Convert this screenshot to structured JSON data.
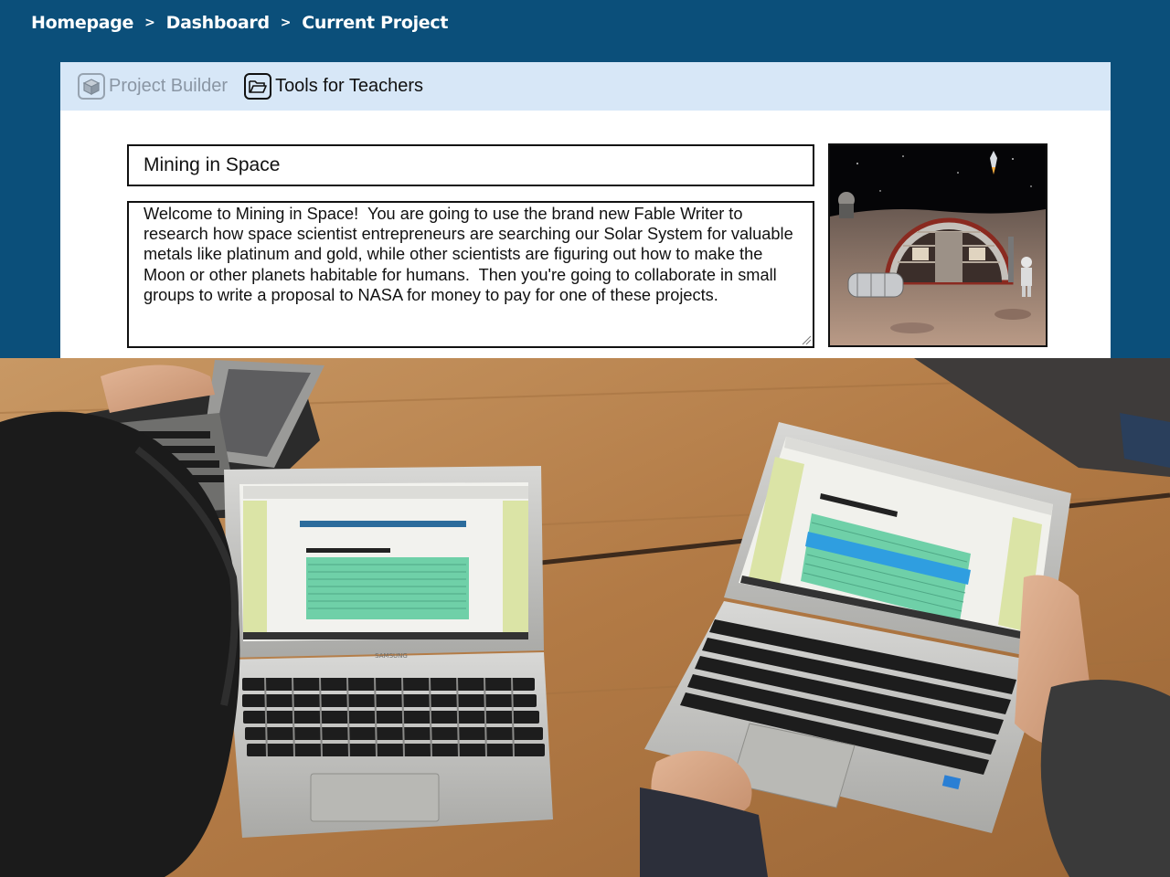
{
  "breadcrumb": {
    "items": [
      "Homepage",
      "Dashboard",
      "Current Project"
    ],
    "separator": ">"
  },
  "tabs": {
    "project_builder": "Project Builder",
    "tools_for_teachers": "Tools for Teachers"
  },
  "project": {
    "title": "Mining in Space",
    "description": "Welcome to Mining in Space!  You are going to use the brand new Fable Writer to research how space scientist entrepreneurs are searching our Solar System for valuable metals like platinum and gold, while other scientists are figuring out how to make the Moon or other planets habitable for humans.  Then you're going to collaborate in small groups to write a proposal to NASA for money to pay for one of these projects."
  },
  "photo": {
    "laptop_brand": "SAMSUNG"
  },
  "colors": {
    "header_bg": "#0b4f7a",
    "tab_bar_bg": "#d7e7f7",
    "table_wood": "#b27a45",
    "highlight_green": "#6fd0a8",
    "highlight_blue": "#2f9ee0"
  },
  "icons": {
    "project_builder": "cube-icon",
    "tools_for_teachers": "folder-icon"
  }
}
